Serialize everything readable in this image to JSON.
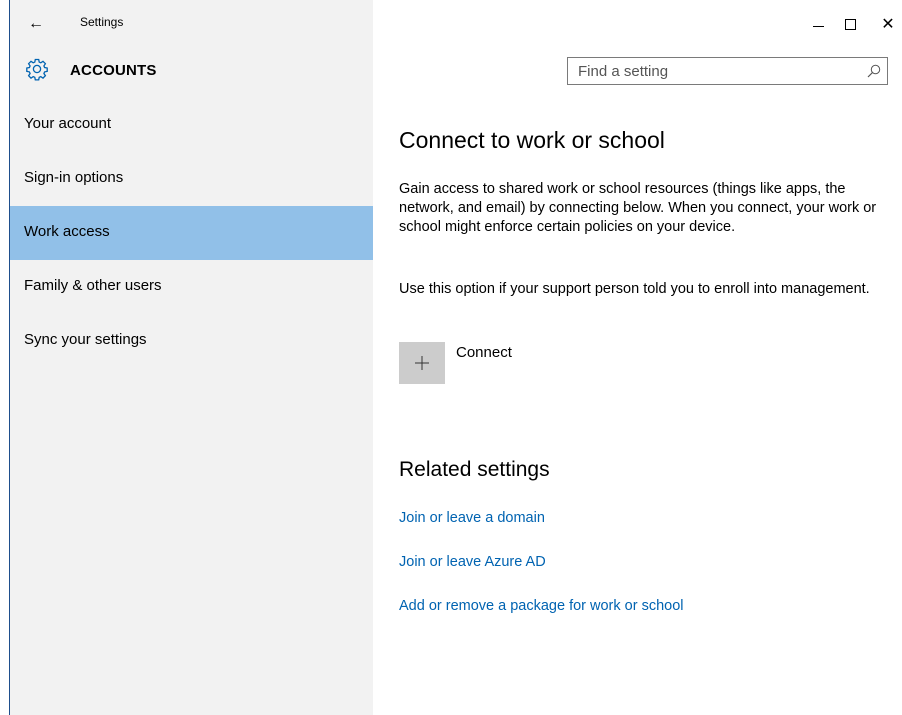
{
  "titlebar": {
    "title": "Settings",
    "back_icon": "←",
    "close_icon": "✕"
  },
  "header": {
    "section_title": "ACCOUNTS",
    "search_placeholder": "Find a setting"
  },
  "sidebar": {
    "items": [
      {
        "label": "Your account",
        "active": false
      },
      {
        "label": "Sign-in options",
        "active": false
      },
      {
        "label": "Work access",
        "active": true
      },
      {
        "label": "Family & other users",
        "active": false
      },
      {
        "label": "Sync your settings",
        "active": false
      }
    ]
  },
  "main": {
    "heading": "Connect to work or school",
    "description": "Gain access to shared work or school resources (things like apps, the network, and email) by connecting below. When you connect, your work or school might enforce certain policies on your device.",
    "enroll_note": "Use this option if your support person told you to enroll into management.",
    "connect_label": "Connect",
    "related_heading": "Related settings",
    "links": [
      "Join or leave a domain",
      "Join or leave Azure AD",
      "Add or remove a package for work or school"
    ]
  },
  "colors": {
    "accent": "#0063b1",
    "nav_active": "#91c0e8",
    "sidebar_bg": "#f2f2f2",
    "button_bg": "#cccccc"
  }
}
